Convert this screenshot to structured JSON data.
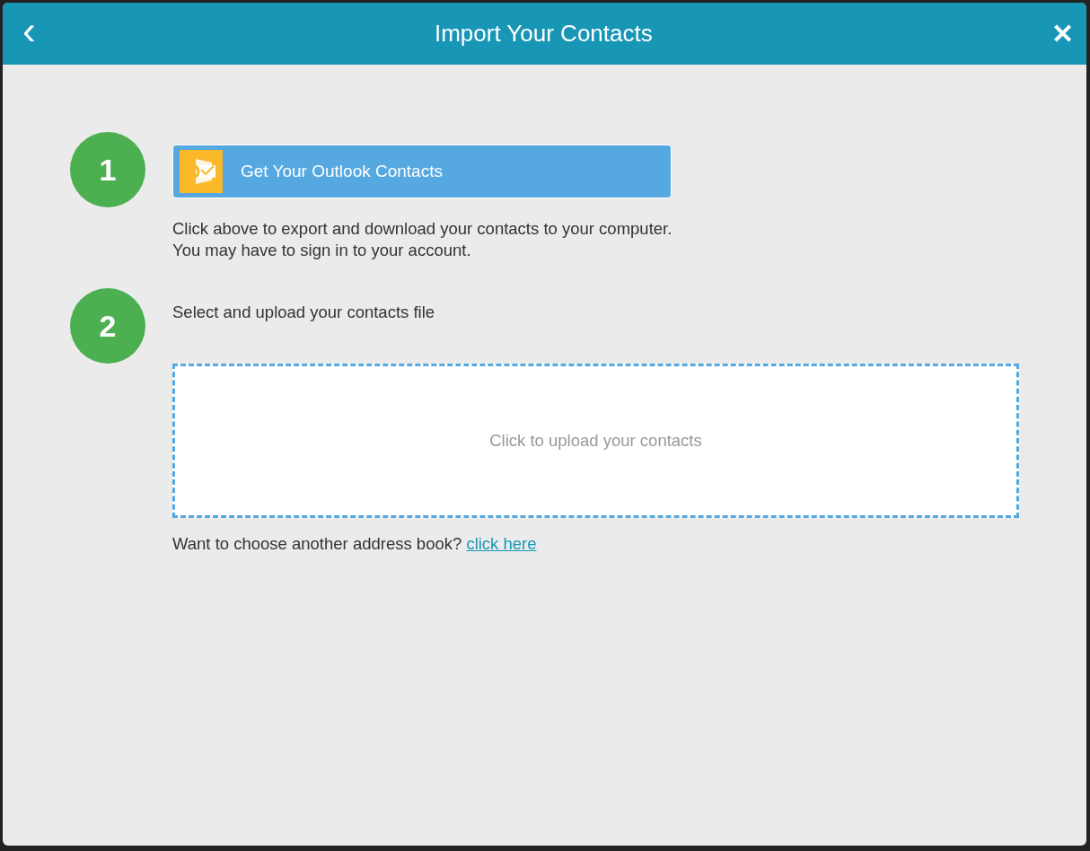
{
  "dialog": {
    "title": "Import Your Contacts",
    "back_icon": "‹",
    "close_icon": "✕"
  },
  "steps": [
    {
      "kind": "export",
      "number": "1",
      "button": "Get Your Outlook Contacts",
      "lines": [
        "Click above to export and download your contacts to your computer.",
        "You may have to sign in to your account."
      ]
    },
    {
      "kind": "upload",
      "number": "2",
      "label": "Select and upload your contacts file",
      "dropzone": "Click to upload your contacts",
      "prompt": "Want to choose another address book?",
      "link": "click here"
    }
  ]
}
